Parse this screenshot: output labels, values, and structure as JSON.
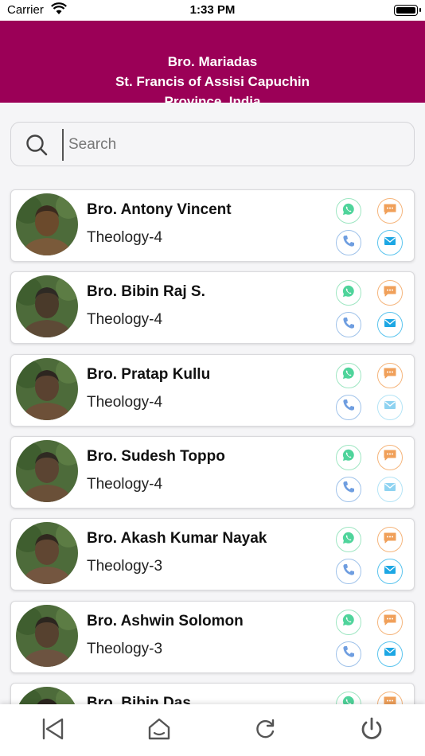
{
  "status_bar": {
    "carrier": "Carrier",
    "time": "1:33 PM"
  },
  "header": {
    "line1": "Bro. Mariadas",
    "line2": "St. Francis of Assisi Capuchin",
    "line3": "Province, India",
    "bg_color": "#9b0057"
  },
  "search": {
    "placeholder": "Search",
    "value": ""
  },
  "contacts": [
    {
      "name": "Bro. Antony Vincent",
      "course": "Theology-4",
      "email_enabled": true
    },
    {
      "name": "Bro. Bibin Raj S.",
      "course": "Theology-4",
      "email_enabled": true
    },
    {
      "name": "Bro. Pratap Kullu",
      "course": "Theology-4",
      "email_enabled": false
    },
    {
      "name": "Bro. Sudesh Toppo",
      "course": "Theology-4",
      "email_enabled": false
    },
    {
      "name": "Bro. Akash Kumar Nayak",
      "course": "Theology-3",
      "email_enabled": true
    },
    {
      "name": "Bro. Ashwin Solomon",
      "course": "Theology-3",
      "email_enabled": true
    },
    {
      "name": "Bro. Bibin Das",
      "course": "",
      "email_enabled": true
    }
  ],
  "action_icons": [
    "whatsapp-icon",
    "message-icon",
    "phone-icon",
    "mail-icon"
  ],
  "bottom_nav": [
    "back-icon",
    "home-icon",
    "refresh-icon",
    "power-icon"
  ],
  "colors": {
    "whatsapp": "#4fd49b",
    "sms": "#f0a05a",
    "phone": "#6f9ee0",
    "mail": "#1da7e4"
  }
}
